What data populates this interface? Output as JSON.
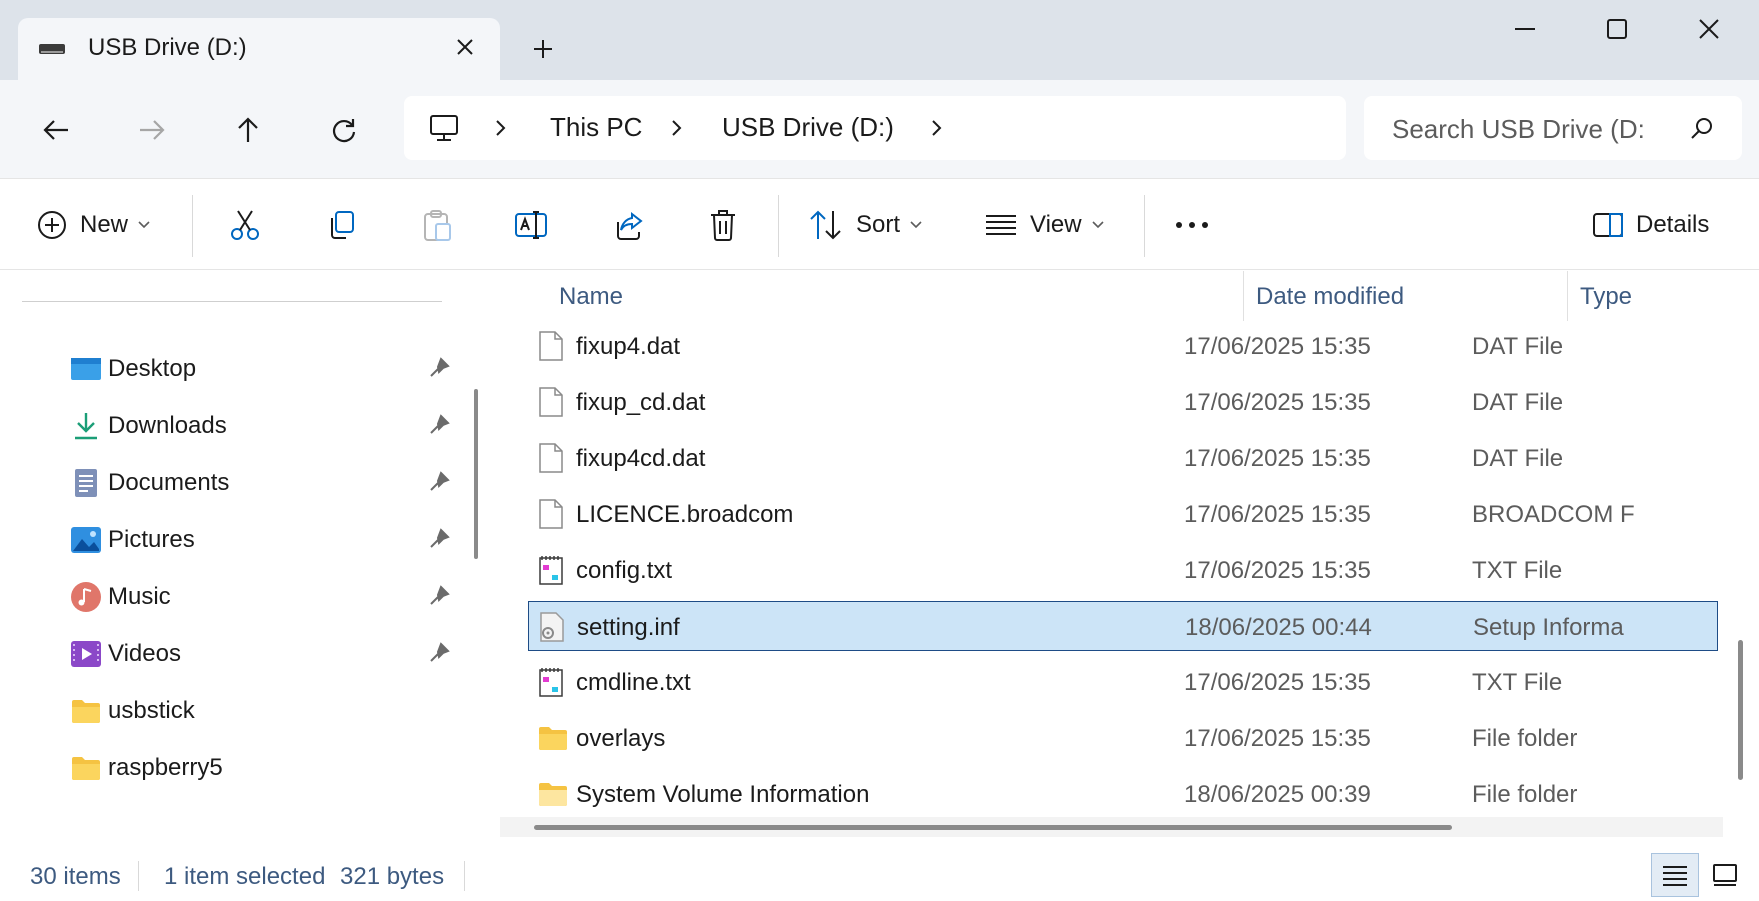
{
  "window": {
    "tab_title": "USB Drive (D:)"
  },
  "nav": {
    "breadcrumb": [
      "This PC",
      "USB Drive (D:)"
    ],
    "search_placeholder": "Search USB Drive (D:"
  },
  "commands": {
    "new_label": "New",
    "sort_label": "Sort",
    "view_label": "View",
    "details_label": "Details"
  },
  "sidebar": {
    "items": [
      {
        "label": "Desktop",
        "icon": "desktop-icon",
        "pinned": true
      },
      {
        "label": "Downloads",
        "icon": "downloads-icon",
        "pinned": true
      },
      {
        "label": "Documents",
        "icon": "documents-icon",
        "pinned": true
      },
      {
        "label": "Pictures",
        "icon": "pictures-icon",
        "pinned": true
      },
      {
        "label": "Music",
        "icon": "music-icon",
        "pinned": true
      },
      {
        "label": "Videos",
        "icon": "videos-icon",
        "pinned": true
      },
      {
        "label": "usbstick",
        "icon": "folder-icon",
        "pinned": false
      },
      {
        "label": "raspberry5",
        "icon": "folder-icon",
        "pinned": false
      }
    ]
  },
  "filelist": {
    "columns": {
      "name": "Name",
      "date": "Date modified",
      "type": "Type"
    },
    "rows": [
      {
        "name": "fixup4.dat",
        "date": "17/06/2025 15:35",
        "type": "DAT File",
        "icon": "file-icon"
      },
      {
        "name": "fixup_cd.dat",
        "date": "17/06/2025 15:35",
        "type": "DAT File",
        "icon": "file-icon"
      },
      {
        "name": "fixup4cd.dat",
        "date": "17/06/2025 15:35",
        "type": "DAT File",
        "icon": "file-icon"
      },
      {
        "name": "LICENCE.broadcom",
        "date": "17/06/2025 15:35",
        "type": "BROADCOM F",
        "icon": "file-icon"
      },
      {
        "name": "config.txt",
        "date": "17/06/2025 15:35",
        "type": "TXT File",
        "icon": "text-file-icon"
      },
      {
        "name": "setting.inf",
        "date": "18/06/2025 00:44",
        "type": "Setup Informa",
        "icon": "setup-file-icon",
        "selected": true
      },
      {
        "name": "cmdline.txt",
        "date": "17/06/2025 15:35",
        "type": "TXT File",
        "icon": "text-file-icon"
      },
      {
        "name": "overlays",
        "date": "17/06/2025 15:35",
        "type": "File folder",
        "icon": "folder-icon"
      },
      {
        "name": "System Volume Information",
        "date": "18/06/2025 00:39",
        "type": "File folder",
        "icon": "folder-icon"
      }
    ]
  },
  "status": {
    "item_count": "30 items",
    "selection": "1 item selected",
    "size": "321 bytes"
  },
  "colors": {
    "accent": "#0067c0",
    "selection_bg": "#cce4f7",
    "selection_border": "#1e4c86",
    "folder": "#f5c342"
  }
}
